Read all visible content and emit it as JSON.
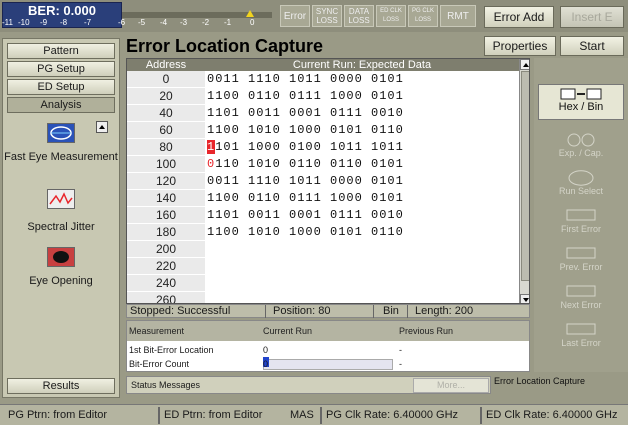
{
  "ber": {
    "title": "BER: 0.000",
    "scale": [
      "-11",
      "-10",
      "-9",
      "-8",
      "-7",
      "-6",
      "-5",
      "-4",
      "-3",
      "-2",
      "-1",
      "0"
    ],
    "level_marker_exponent": -1
  },
  "indicators": [
    {
      "label": "Error"
    },
    {
      "label": "SYNC LOSS"
    },
    {
      "label": "DATA LOSS"
    },
    {
      "label": "ED CLK LOSS"
    },
    {
      "label": "PG CLK LOSS"
    },
    {
      "label": "RMT"
    }
  ],
  "top_buttons": {
    "error_add": "Error Add",
    "insert_e": "Insert E"
  },
  "left_panel": {
    "tabs": [
      "Pattern",
      "PG Setup",
      "ED Setup",
      "Analysis"
    ],
    "tools": [
      {
        "label": "Fast Eye Measurement",
        "icon": "fast-eye-icon"
      },
      {
        "label": "Spectral Jitter",
        "icon": "spectral-jitter-icon"
      },
      {
        "label": "Eye Opening",
        "icon": "eye-opening-icon"
      }
    ],
    "results": "Results"
  },
  "main": {
    "title": "Error Location Capture",
    "col_address": "Address",
    "col_run": "Current Run: Expected Data",
    "rows": [
      {
        "addr": "0",
        "data": "0011 1110 1011 0000 0101"
      },
      {
        "addr": "20",
        "data": "1100 0110 0111 1000 0101"
      },
      {
        "addr": "40",
        "data": "1101 0011 0001 0111 0010"
      },
      {
        "addr": "60",
        "data": "1100 1010 1000 0101 0110"
      },
      {
        "addr": "80",
        "data": "1101 1000 0100 1011 1011"
      },
      {
        "addr": "100",
        "data": "0110 1010 0110 0110 0101"
      },
      {
        "addr": "120",
        "data": "0011 1110 1011 0000 0101"
      },
      {
        "addr": "140",
        "data": "1100 0110 0111 1000 0101"
      },
      {
        "addr": "160",
        "data": "1101 0011 0001 0111 0010"
      },
      {
        "addr": "180",
        "data": "1100 1010 1000 0101 0110"
      },
      {
        "addr": "200",
        "data": ""
      },
      {
        "addr": "220",
        "data": ""
      },
      {
        "addr": "240",
        "data": ""
      },
      {
        "addr": "260",
        "data": ""
      }
    ],
    "status": {
      "state": "Stopped: Successful",
      "position": "Position: 80",
      "format": "Bin",
      "length": "Length: 200"
    },
    "measurement": {
      "col1": "Measurement",
      "col2": "Current Run",
      "col3": "Previous Run",
      "rows": [
        {
          "name": "1st Bit-Error Location",
          "current": "0",
          "previous": "-"
        },
        {
          "name": "Bit-Error Count",
          "current": "0",
          "previous": "-"
        }
      ]
    },
    "status_messages": "Status Messages",
    "more": "More...",
    "result_label": "Error Location Capture"
  },
  "right_panel": {
    "properties": "Properties",
    "start": "Start",
    "buttons": [
      {
        "label": "Hex / Bin",
        "enabled": true
      },
      {
        "label": "Exp. / Cap.",
        "enabled": false
      },
      {
        "label": "Run Select",
        "enabled": false
      },
      {
        "label": "First Error",
        "enabled": false
      },
      {
        "label": "Prev. Error",
        "enabled": false
      },
      {
        "label": "Next Error",
        "enabled": false
      },
      {
        "label": "Last Error",
        "enabled": false
      }
    ]
  },
  "bottom_bar": {
    "pg_ptrn": "PG Ptrn: from Editor",
    "ed_ptrn": "ED Ptrn: from Editor",
    "mas": "MAS",
    "pg_clk": "PG Clk Rate: 6.40000 GHz",
    "ed_clk": "ED Clk Rate: 6.40000 GHz"
  },
  "colors": {
    "error_cell": "#e8262b",
    "ber_box": "#2a3f7a",
    "cursor": "#2244cc"
  }
}
